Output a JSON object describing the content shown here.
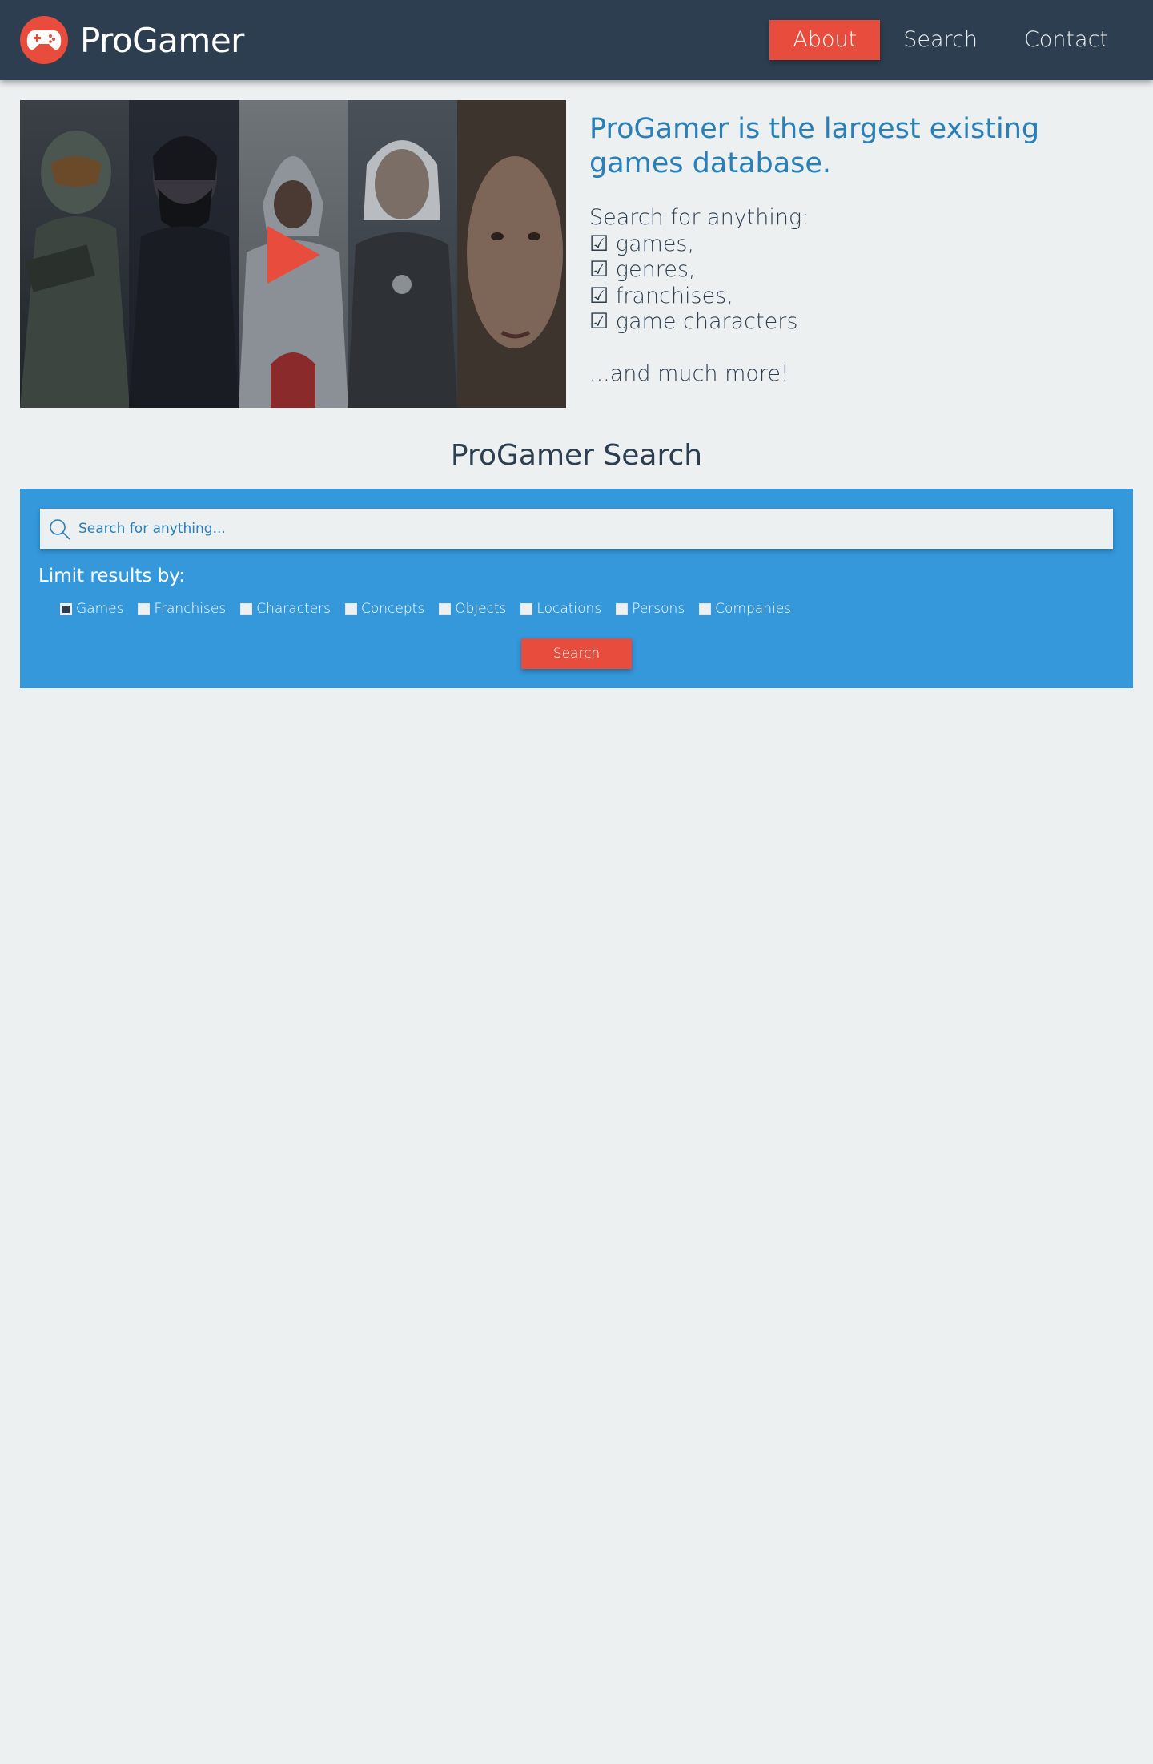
{
  "header": {
    "logo_text": "ProGamer",
    "nav": [
      {
        "label": "About",
        "active": true
      },
      {
        "label": "Search",
        "active": false
      },
      {
        "label": "Contact",
        "active": false
      }
    ]
  },
  "hero": {
    "title": "ProGamer is the largest existing games database.",
    "lead": "Search for anything:",
    "list": [
      "☑ games,",
      "☑ genres,",
      "☑ franchises,",
      "☑ game characters"
    ],
    "more": "...and much more!"
  },
  "search": {
    "title": "ProGamer Search",
    "placeholder": "Search for anything...",
    "limit_label": "Limit results by:",
    "filters": [
      {
        "label": "Games",
        "checked": true
      },
      {
        "label": "Franchises",
        "checked": false
      },
      {
        "label": "Characters",
        "checked": false
      },
      {
        "label": "Concepts",
        "checked": false
      },
      {
        "label": "Objects",
        "checked": false
      },
      {
        "label": "Locations",
        "checked": false
      },
      {
        "label": "Persons",
        "checked": false
      },
      {
        "label": "Companies",
        "checked": false
      }
    ],
    "button_label": "Search"
  },
  "colors": {
    "header_bg": "#2c3e50",
    "accent": "#e74c3c",
    "search_panel": "#3498db",
    "title_blue": "#2980b9",
    "page_bg": "#ecf0f1"
  },
  "icons": [
    "gamepad-icon",
    "play-icon",
    "search-icon"
  ]
}
